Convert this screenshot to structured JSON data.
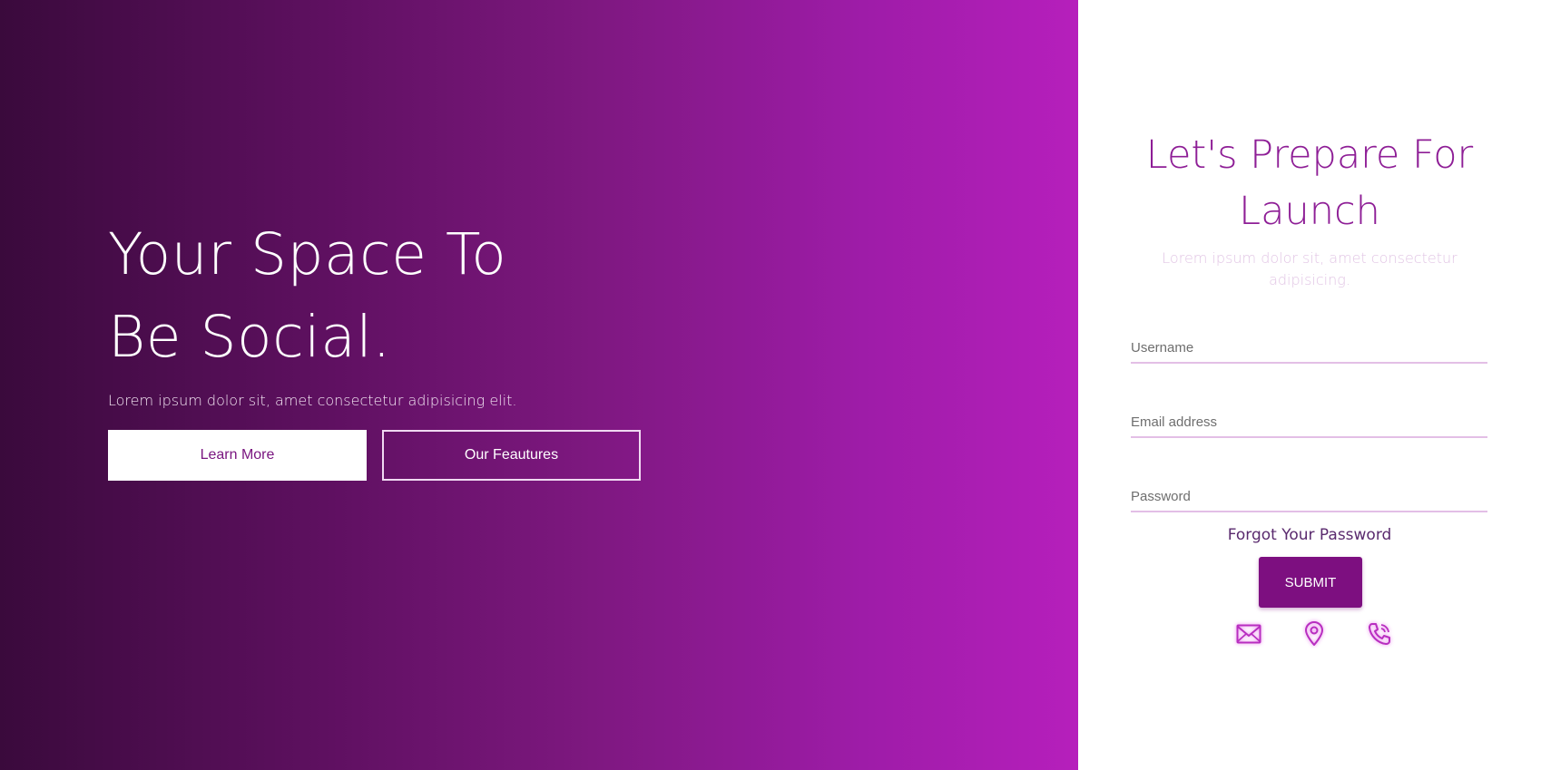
{
  "hero": {
    "title": "Your Space To Be Social.",
    "text": "Lorem ipsum dolor sit, amet consectetur adipisicing elit.",
    "primary_button": "Learn More",
    "secondary_button": "Our Feautures"
  },
  "panel": {
    "title": "Let's Prepare For Launch",
    "subtitle": "Lorem ipsum dolor sit, amet consectetur adipisicing.",
    "username_placeholder": "Username",
    "email_placeholder": "Email address",
    "password_placeholder": "Password",
    "forgot_password": "Forgot Your Password",
    "submit": "SUBMIT",
    "icons": [
      "mail-icon",
      "location-pin-icon",
      "phone-icon"
    ]
  },
  "colors": {
    "gradient_start": "#3a0a3c",
    "gradient_end": "#b61fbc",
    "accent": "#7d0f80",
    "title": "#8e1e96"
  }
}
